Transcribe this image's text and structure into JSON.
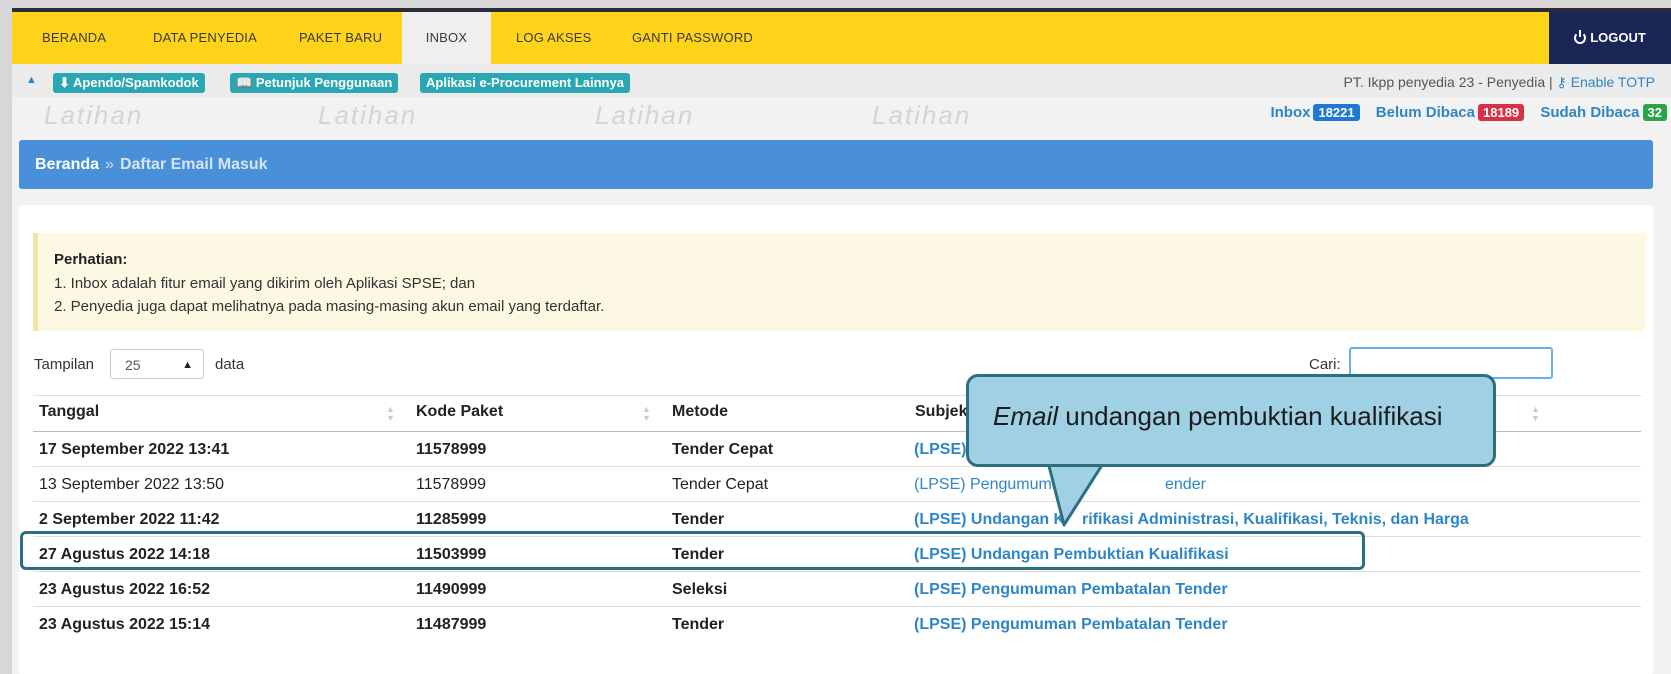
{
  "nav": {
    "items": [
      "BERANDA",
      "DATA PENYEDIA",
      "PAKET BARU",
      "INBOX",
      "LOG AKSES",
      "GANTI PASSWORD"
    ],
    "active": "INBOX",
    "logout": "LOGOUT"
  },
  "subbar": {
    "link1": "Apendo/Spamkodok",
    "link2": "Petunjuk Penggunaan",
    "link3": "Aplikasi e-Procurement Lainnya",
    "user": "PT. Ikpp penyedia 23 - Penyedia |",
    "totp": "Enable TOTP"
  },
  "watermark": "Latihan",
  "counts": {
    "inbox_label": "Inbox",
    "inbox": "18221",
    "unread_label": "Belum Dibaca",
    "unread": "18189",
    "read_label": "Sudah Dibaca",
    "read": "32"
  },
  "breadcrumb": {
    "home": "Beranda",
    "sep": "»",
    "current": "Daftar Email Masuk"
  },
  "alert": {
    "title": "Perhatian:",
    "line1": "1. Inbox adalah fitur email yang dikirim oleh Aplikasi SPSE; dan",
    "line2": "2. Penyedia juga dapat melihatnya pada masing-masing akun email yang terdaftar."
  },
  "table_controls": {
    "show_label": "Tampilan",
    "page_size": "25",
    "data_label": "data",
    "search_label": "Cari:"
  },
  "table": {
    "headers": [
      "Tanggal",
      "Kode Paket",
      "Metode",
      "Subjek"
    ],
    "rows": [
      {
        "date": "17 September 2022 13:41",
        "code": "11578999",
        "method": "Tender Cepat",
        "subject": "(LPSE)",
        "bold": true
      },
      {
        "date": "13 September 2022 13:50",
        "code": "11578999",
        "method": "Tender Cepat",
        "subject": "(LPSE) Pengumuma",
        "subject2": "ender",
        "bold": false
      },
      {
        "date": "2 September 2022 11:42",
        "code": "11285999",
        "method": "Tender",
        "subject": "(LPSE) Undangan K",
        "subject2": "rifikasi Administrasi, Kualifikasi, Teknis, dan Harga",
        "bold": true
      },
      {
        "date": "27 Agustus 2022 14:18",
        "code": "11503999",
        "method": "Tender",
        "subject": "(LPSE) Undangan Pembuktian Kualifikasi",
        "bold": true
      },
      {
        "date": "23 Agustus 2022 16:52",
        "code": "11490999",
        "method": "Seleksi",
        "subject": "(LPSE) Pengumuman Pembatalan Tender",
        "bold": true
      },
      {
        "date": "23 Agustus 2022 15:14",
        "code": "11487999",
        "method": "Tender",
        "subject": "(LPSE) Pengumuman Pembatalan Tender",
        "bold": true
      }
    ]
  },
  "callout": {
    "em": "Email",
    "rest": " undangan pembuktian kualifikasi"
  },
  "colors": {
    "nav": "#ffd31a",
    "logout": "#1b2556",
    "breadcrumb": "#4a90d9",
    "link": "#2e86c9",
    "badge_blue": "#1f78d1",
    "badge_red": "#d9304a",
    "badge_green": "#2ca24a",
    "callout": "#9fd0e3"
  }
}
